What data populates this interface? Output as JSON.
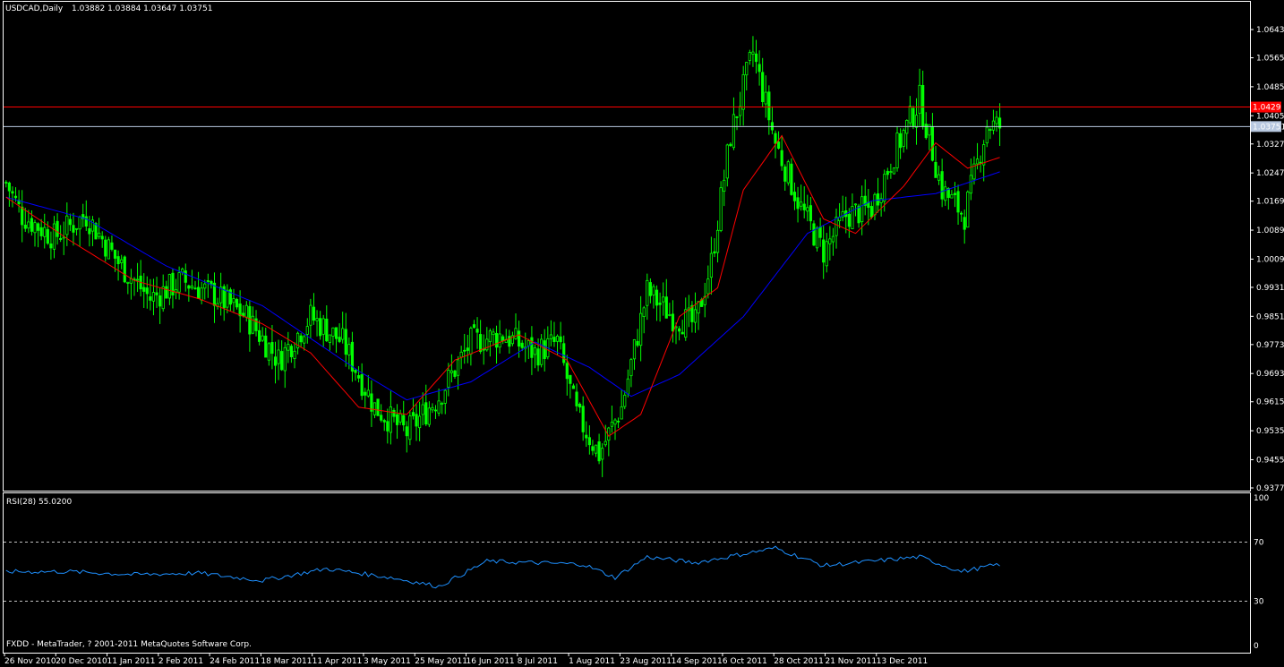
{
  "header": {
    "title": "USDCAD,Daily",
    "ohlc": "1.03882 1.03884 1.03647 1.03751"
  },
  "rsi_header": "RSI(28) 55.0200",
  "copyright": "FXDD - MetaTrader, ? 2001-2011 MetaQuotes Software Corp.",
  "hlines": [
    {
      "value": 1.0429,
      "label": "1.0429",
      "color": "#ff0000"
    },
    {
      "value": 1.03751,
      "label": "1.03751",
      "color": "#b8c8e0"
    }
  ],
  "colors": {
    "background": "#000000",
    "frame": "#ffffff",
    "candle": "#00ff00",
    "ma_fast": "#ff0000",
    "ma_slow": "#0000ff",
    "rsi_line": "#1e90ff"
  },
  "chart_data": [
    {
      "type": "candlestick",
      "title": "USDCAD,Daily",
      "ylim": [
        0.9377,
        1.0643
      ],
      "y_ticks": [
        "1.06430",
        "1.05650",
        "1.04850",
        "1.04050",
        "1.03270",
        "1.02470",
        "1.01690",
        "1.00890",
        "1.00090",
        "0.99310",
        "0.98510",
        "0.97730",
        "0.96930",
        "0.96150",
        "0.95350",
        "0.94550",
        "0.93770"
      ],
      "x_ticks": [
        "26 Nov 2010",
        "20 Dec 2010",
        "11 Jan 2011",
        "2 Feb 2011",
        "24 Feb 2011",
        "18 Mar 2011",
        "11 Apr 2011",
        "3 May 2011",
        "25 May 2011",
        "16 Jun 2011",
        "8 Jul 2011",
        "1 Aug 2011",
        "23 Aug 2011",
        "14 Sep 2011",
        "6 Oct 2011",
        "28 Oct 2011",
        "21 Nov 2011",
        "13 Dec 2011"
      ],
      "close_path": [
        [
          0,
          1.022
        ],
        [
          5,
          1.013
        ],
        [
          15,
          1.007
        ],
        [
          25,
          1.013
        ],
        [
          35,
          1.0
        ],
        [
          45,
          0.99
        ],
        [
          55,
          0.995
        ],
        [
          65,
          0.991
        ],
        [
          75,
          0.985
        ],
        [
          85,
          0.973
        ],
        [
          95,
          0.985
        ],
        [
          105,
          0.978
        ],
        [
          115,
          0.96
        ],
        [
          125,
          0.953
        ],
        [
          135,
          0.963
        ],
        [
          145,
          0.978
        ],
        [
          155,
          0.98
        ],
        [
          165,
          0.975
        ],
        [
          172,
          0.978
        ],
        [
          178,
          0.958
        ],
        [
          185,
          0.947
        ],
        [
          192,
          0.96
        ],
        [
          200,
          0.992
        ],
        [
          208,
          0.985
        ],
        [
          215,
          0.983
        ],
        [
          220,
          1.0
        ],
        [
          226,
          1.035
        ],
        [
          233,
          1.058
        ],
        [
          240,
          1.033
        ],
        [
          248,
          1.015
        ],
        [
          255,
          1.003
        ],
        [
          262,
          1.013
        ],
        [
          270,
          1.015
        ],
        [
          277,
          1.03
        ],
        [
          285,
          1.045
        ],
        [
          292,
          1.02
        ],
        [
          299,
          1.013
        ],
        [
          306,
          1.038
        ],
        [
          310,
          1.0375
        ]
      ],
      "ma_fast_path": [
        [
          0,
          1.018
        ],
        [
          20,
          1.006
        ],
        [
          40,
          0.995
        ],
        [
          60,
          0.99
        ],
        [
          80,
          0.983
        ],
        [
          95,
          0.975
        ],
        [
          110,
          0.96
        ],
        [
          125,
          0.958
        ],
        [
          140,
          0.973
        ],
        [
          160,
          0.98
        ],
        [
          175,
          0.973
        ],
        [
          188,
          0.952
        ],
        [
          198,
          0.958
        ],
        [
          210,
          0.985
        ],
        [
          222,
          0.993
        ],
        [
          230,
          1.02
        ],
        [
          242,
          1.035
        ],
        [
          255,
          1.012
        ],
        [
          265,
          1.008
        ],
        [
          280,
          1.021
        ],
        [
          290,
          1.033
        ],
        [
          300,
          1.026
        ],
        [
          310,
          1.029
        ]
      ],
      "ma_slow_path": [
        [
          0,
          1.018
        ],
        [
          25,
          1.012
        ],
        [
          50,
          0.999
        ],
        [
          80,
          0.988
        ],
        [
          110,
          0.97
        ],
        [
          125,
          0.962
        ],
        [
          145,
          0.967
        ],
        [
          165,
          0.978
        ],
        [
          182,
          0.971
        ],
        [
          195,
          0.963
        ],
        [
          210,
          0.969
        ],
        [
          230,
          0.985
        ],
        [
          250,
          1.008
        ],
        [
          270,
          1.017
        ],
        [
          290,
          1.019
        ],
        [
          310,
          1.025
        ]
      ]
    },
    {
      "type": "line",
      "title": "RSI(28) 55.0200",
      "ylim": [
        0,
        100
      ],
      "y_ticks": [
        "100",
        "70",
        "30",
        "0"
      ],
      "levels": [
        70,
        30
      ],
      "x": [
        0,
        20,
        40,
        60,
        80,
        100,
        120,
        135,
        150,
        165,
        180,
        190,
        200,
        215,
        230,
        240,
        255,
        270,
        285,
        298,
        310
      ],
      "values": [
        50,
        50,
        48,
        49,
        44,
        52,
        46,
        40,
        57,
        56,
        55,
        46,
        60,
        56,
        62,
        66,
        54,
        57,
        60,
        50,
        55.02
      ]
    }
  ]
}
